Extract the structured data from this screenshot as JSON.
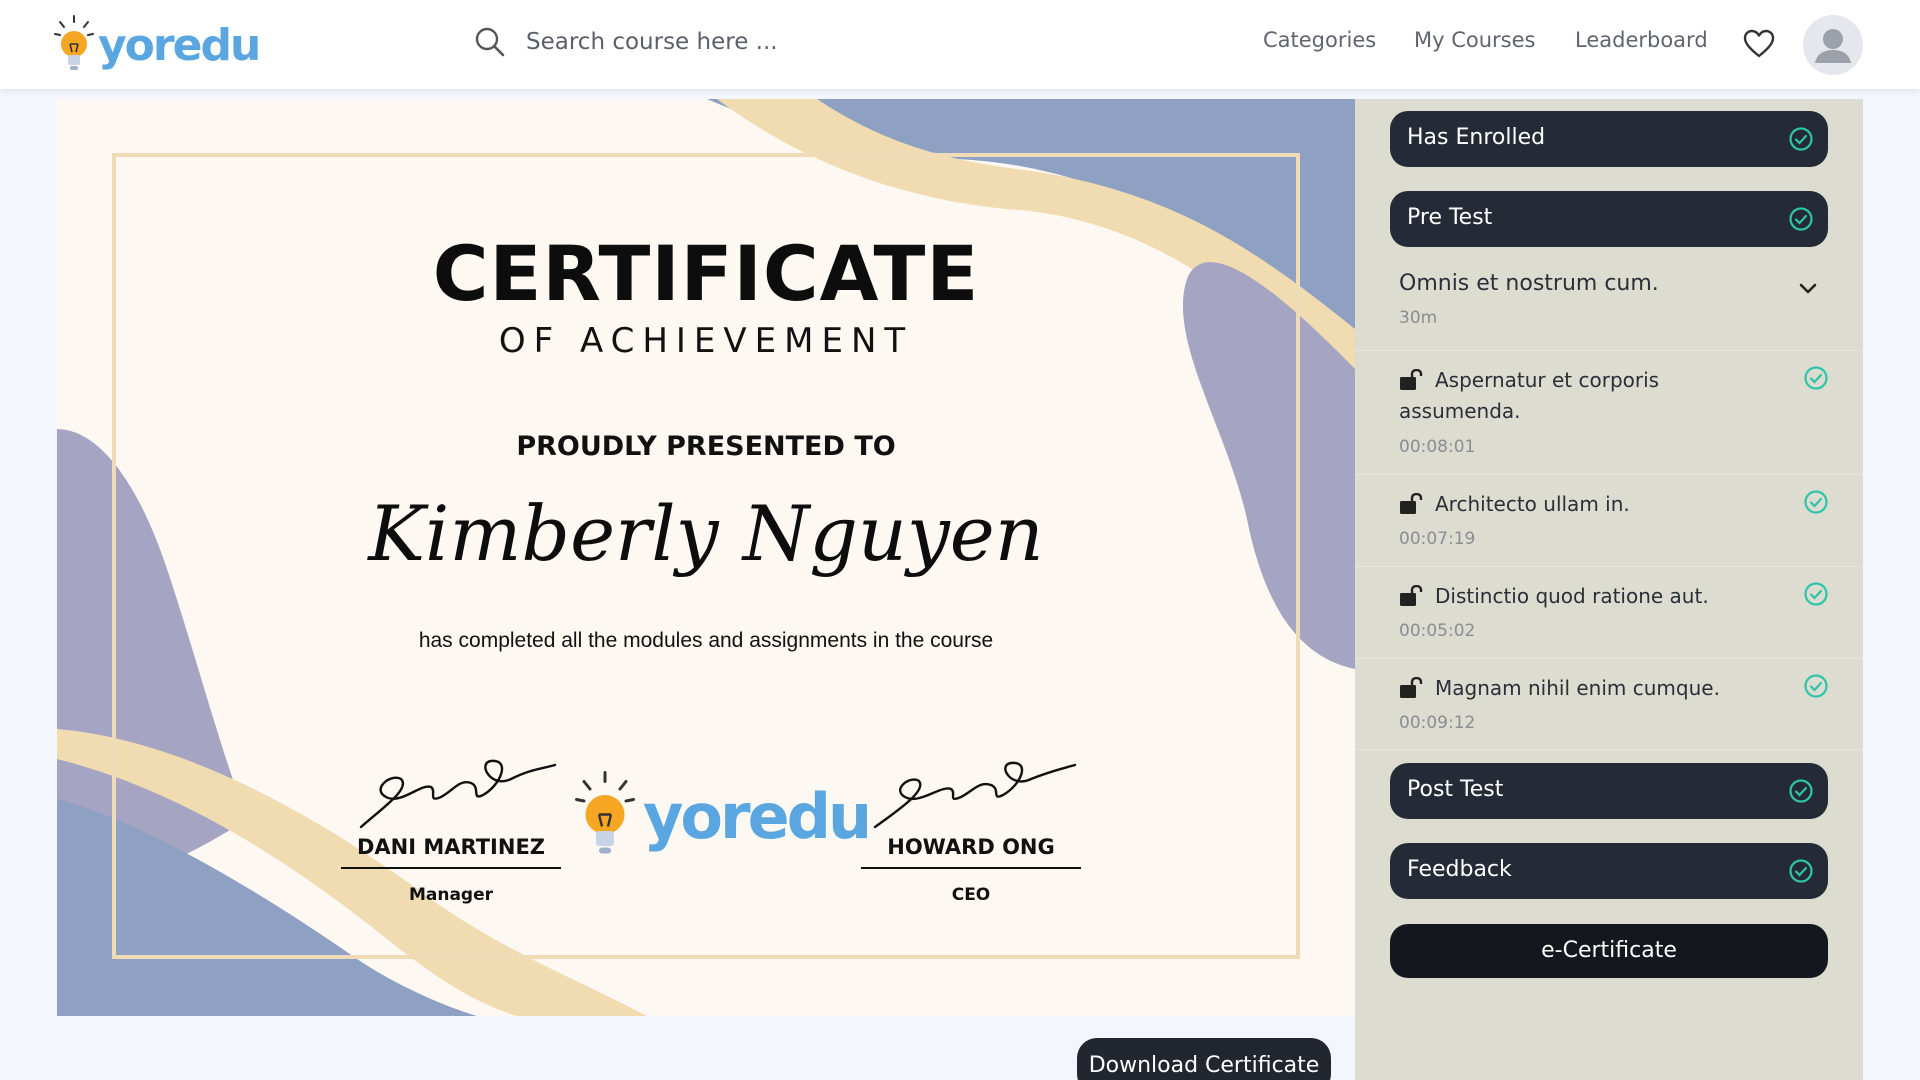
{
  "header": {
    "logo_text": "yoredu",
    "search_placeholder": "Search course here ...",
    "nav": {
      "categories": "Categories",
      "my_courses": "My Courses",
      "leaderboard": "Leaderboard"
    }
  },
  "certificate": {
    "title": "CERTIFICATE",
    "subtitle": "OF ACHIEVEMENT",
    "presented_to": "PROUDLY PRESENTED TO",
    "recipient": "Kimberly Nguyen",
    "completion_text": "has completed all the modules and assignments in the course",
    "logo_text": "yoredu",
    "signatories": [
      {
        "name": "DANI MARTINEZ",
        "role": "Manager"
      },
      {
        "name": "HOWARD ONG",
        "role": "CEO"
      }
    ],
    "colors": {
      "wave_blue": "#8fa1c3",
      "wave_purple": "#a5a4c2",
      "wave_cream": "#f0dcb0",
      "paper": "#fdf8f2"
    }
  },
  "download_label": "Download Certificate",
  "sidebar": {
    "has_enrolled": "Has Enrolled",
    "pre_test": "Pre Test",
    "section": {
      "title": "Omnis et nostrum cum.",
      "duration": "30m"
    },
    "lessons": [
      {
        "title": "Aspernatur et corporis assumenda.",
        "time": "00:08:01"
      },
      {
        "title": "Architecto ullam in.",
        "time": "00:07:19"
      },
      {
        "title": "Distinctio quod ratione aut.",
        "time": "00:05:02"
      },
      {
        "title": "Magnam nihil enim cumque.",
        "time": "00:09:12"
      }
    ],
    "post_test": "Post Test",
    "feedback": "Feedback",
    "e_certificate": "e-Certificate",
    "check_color": "#2ec4a8"
  }
}
